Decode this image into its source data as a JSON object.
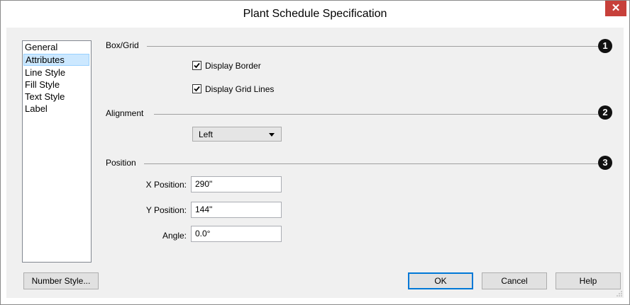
{
  "window": {
    "title": "Plant Schedule Specification",
    "close_glyph": "✕"
  },
  "categories": [
    {
      "label": "General",
      "selected": false
    },
    {
      "label": "Attributes",
      "selected": true
    },
    {
      "label": "Line Style",
      "selected": false
    },
    {
      "label": "Fill Style",
      "selected": false
    },
    {
      "label": "Text Style",
      "selected": false
    },
    {
      "label": "Label",
      "selected": false
    }
  ],
  "box_grid": {
    "label": "Box/Grid",
    "badge": "1",
    "display_border": {
      "label": "Display Border",
      "checked": true
    },
    "display_grid_lines": {
      "label": "Display Grid Lines",
      "checked": true
    }
  },
  "alignment": {
    "label": "Alignment",
    "badge": "2",
    "selected": "Left"
  },
  "position": {
    "label": "Position",
    "badge": "3",
    "x_label": "X Position:",
    "x_value": "290\"",
    "y_label": "Y Position:",
    "y_value": "144\"",
    "angle_label": "Angle:",
    "angle_value": "0.0°"
  },
  "buttons": {
    "number_style": "Number Style...",
    "ok": "OK",
    "cancel": "Cancel",
    "help": "Help"
  }
}
